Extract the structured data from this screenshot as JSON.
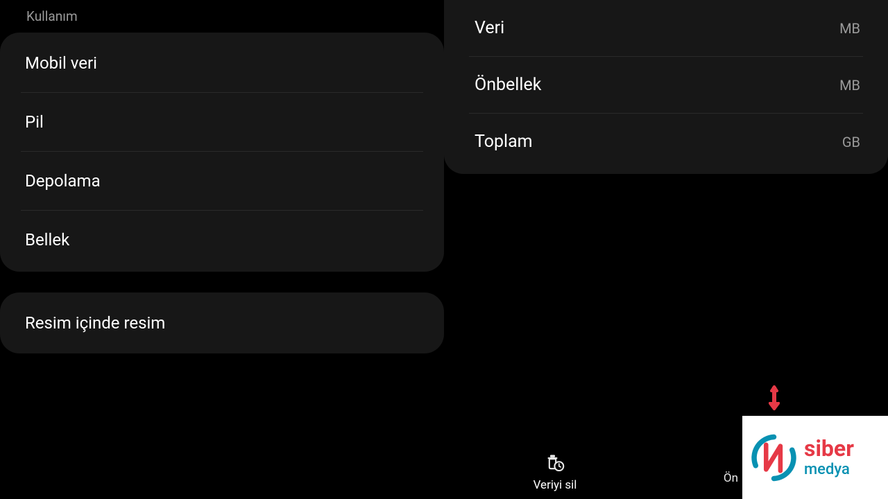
{
  "left": {
    "section_header": "Kullanım",
    "usage_items": [
      "Mobil veri",
      "Pil",
      "Depolama",
      "Bellek"
    ],
    "pip_label": "Resim içinde resim"
  },
  "right": {
    "storage_rows": [
      {
        "label": "Veri",
        "unit": "MB"
      },
      {
        "label": "Önbellek",
        "unit": "MB"
      },
      {
        "label": "Toplam",
        "unit": "GB"
      }
    ]
  },
  "actions": {
    "clear_data": "Veriyi sil",
    "clear_cache_partial": "Ön"
  },
  "logo": {
    "line1": "siber",
    "line2": "medya"
  }
}
